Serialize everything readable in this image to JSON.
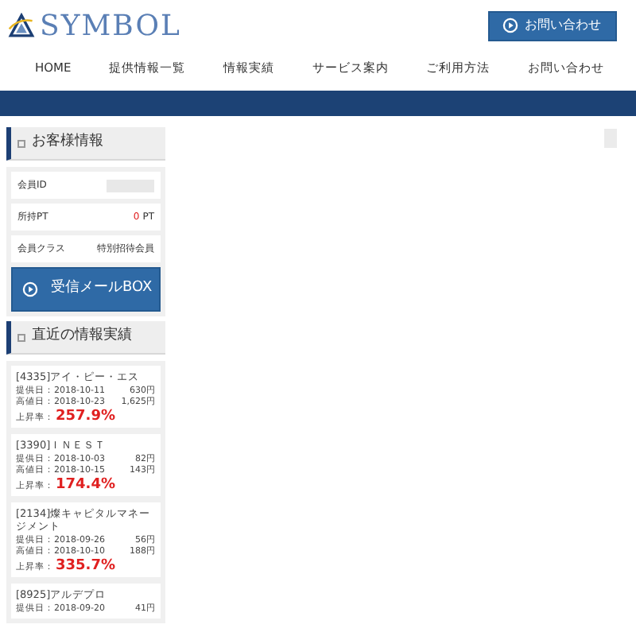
{
  "header": {
    "logo": "SYMBOL",
    "contact_button": "お問い合わせ"
  },
  "nav": [
    {
      "label": "HOME"
    },
    {
      "label": "提供情報一覧"
    },
    {
      "label": "情報実績"
    },
    {
      "label": "サービス案内"
    },
    {
      "label": "ご利用方法"
    },
    {
      "label": "お問い合わせ"
    }
  ],
  "customer_info": {
    "title": "お客様情報",
    "rows": [
      {
        "kind": "hidden",
        "label": "会員ID"
      },
      {
        "kind": "points",
        "label": "所持PT",
        "value": "0",
        "unit": "PT"
      },
      {
        "kind": "text",
        "label": "会員クラス",
        "value": "特別招待会員"
      }
    ],
    "mail_button": "受信メールBOX"
  },
  "recent_results": {
    "title": "直近の情報実績",
    "items": [
      {
        "name": "[4335]アイ・ピー・エス",
        "provided_label": "提供日：",
        "provided_date": "2018-10-11",
        "provided_price": "630円",
        "high_label": "高値日：",
        "high_date": "2018-10-23",
        "high_price": "1,625円",
        "rate_label": "上昇率：",
        "rate": "257.9%"
      },
      {
        "name": "[3390]ＩＮＥＳＴ",
        "provided_label": "提供日：",
        "provided_date": "2018-10-03",
        "provided_price": "82円",
        "high_label": "高値日：",
        "high_date": "2018-10-15",
        "high_price": "143円",
        "rate_label": "上昇率：",
        "rate": "174.4%"
      },
      {
        "name": "[2134]燦キャピタルマネージメント",
        "provided_label": "提供日：",
        "provided_date": "2018-09-26",
        "provided_price": "56円",
        "high_label": "高値日：",
        "high_date": "2018-10-10",
        "high_price": "188円",
        "rate_label": "上昇率：",
        "rate": "335.7%"
      },
      {
        "name": "[8925]アルデプロ",
        "provided_label": "提供日：",
        "provided_date": "2018-09-20",
        "provided_price": "41円"
      }
    ]
  }
}
